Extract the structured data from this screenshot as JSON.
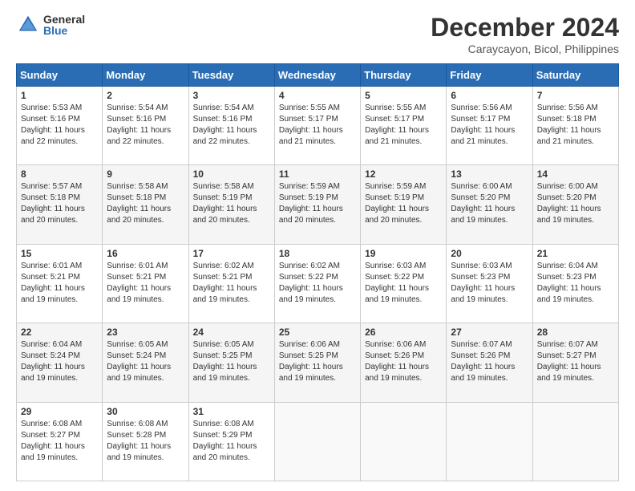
{
  "header": {
    "logo_general": "General",
    "logo_blue": "Blue",
    "title": "December 2024",
    "subtitle": "Caraycayon, Bicol, Philippines"
  },
  "weekdays": [
    "Sunday",
    "Monday",
    "Tuesday",
    "Wednesday",
    "Thursday",
    "Friday",
    "Saturday"
  ],
  "weeks": [
    [
      {
        "day": 1,
        "sunrise": "5:53 AM",
        "sunset": "5:16 PM",
        "daylight": "11 hours and 22 minutes."
      },
      {
        "day": 2,
        "sunrise": "5:54 AM",
        "sunset": "5:16 PM",
        "daylight": "11 hours and 22 minutes."
      },
      {
        "day": 3,
        "sunrise": "5:54 AM",
        "sunset": "5:16 PM",
        "daylight": "11 hours and 22 minutes."
      },
      {
        "day": 4,
        "sunrise": "5:55 AM",
        "sunset": "5:17 PM",
        "daylight": "11 hours and 21 minutes."
      },
      {
        "day": 5,
        "sunrise": "5:55 AM",
        "sunset": "5:17 PM",
        "daylight": "11 hours and 21 minutes."
      },
      {
        "day": 6,
        "sunrise": "5:56 AM",
        "sunset": "5:17 PM",
        "daylight": "11 hours and 21 minutes."
      },
      {
        "day": 7,
        "sunrise": "5:56 AM",
        "sunset": "5:18 PM",
        "daylight": "11 hours and 21 minutes."
      }
    ],
    [
      {
        "day": 8,
        "sunrise": "5:57 AM",
        "sunset": "5:18 PM",
        "daylight": "11 hours and 20 minutes."
      },
      {
        "day": 9,
        "sunrise": "5:58 AM",
        "sunset": "5:18 PM",
        "daylight": "11 hours and 20 minutes."
      },
      {
        "day": 10,
        "sunrise": "5:58 AM",
        "sunset": "5:19 PM",
        "daylight": "11 hours and 20 minutes."
      },
      {
        "day": 11,
        "sunrise": "5:59 AM",
        "sunset": "5:19 PM",
        "daylight": "11 hours and 20 minutes."
      },
      {
        "day": 12,
        "sunrise": "5:59 AM",
        "sunset": "5:19 PM",
        "daylight": "11 hours and 20 minutes."
      },
      {
        "day": 13,
        "sunrise": "6:00 AM",
        "sunset": "5:20 PM",
        "daylight": "11 hours and 19 minutes."
      },
      {
        "day": 14,
        "sunrise": "6:00 AM",
        "sunset": "5:20 PM",
        "daylight": "11 hours and 19 minutes."
      }
    ],
    [
      {
        "day": 15,
        "sunrise": "6:01 AM",
        "sunset": "5:21 PM",
        "daylight": "11 hours and 19 minutes."
      },
      {
        "day": 16,
        "sunrise": "6:01 AM",
        "sunset": "5:21 PM",
        "daylight": "11 hours and 19 minutes."
      },
      {
        "day": 17,
        "sunrise": "6:02 AM",
        "sunset": "5:21 PM",
        "daylight": "11 hours and 19 minutes."
      },
      {
        "day": 18,
        "sunrise": "6:02 AM",
        "sunset": "5:22 PM",
        "daylight": "11 hours and 19 minutes."
      },
      {
        "day": 19,
        "sunrise": "6:03 AM",
        "sunset": "5:22 PM",
        "daylight": "11 hours and 19 minutes."
      },
      {
        "day": 20,
        "sunrise": "6:03 AM",
        "sunset": "5:23 PM",
        "daylight": "11 hours and 19 minutes."
      },
      {
        "day": 21,
        "sunrise": "6:04 AM",
        "sunset": "5:23 PM",
        "daylight": "11 hours and 19 minutes."
      }
    ],
    [
      {
        "day": 22,
        "sunrise": "6:04 AM",
        "sunset": "5:24 PM",
        "daylight": "11 hours and 19 minutes."
      },
      {
        "day": 23,
        "sunrise": "6:05 AM",
        "sunset": "5:24 PM",
        "daylight": "11 hours and 19 minutes."
      },
      {
        "day": 24,
        "sunrise": "6:05 AM",
        "sunset": "5:25 PM",
        "daylight": "11 hours and 19 minutes."
      },
      {
        "day": 25,
        "sunrise": "6:06 AM",
        "sunset": "5:25 PM",
        "daylight": "11 hours and 19 minutes."
      },
      {
        "day": 26,
        "sunrise": "6:06 AM",
        "sunset": "5:26 PM",
        "daylight": "11 hours and 19 minutes."
      },
      {
        "day": 27,
        "sunrise": "6:07 AM",
        "sunset": "5:26 PM",
        "daylight": "11 hours and 19 minutes."
      },
      {
        "day": 28,
        "sunrise": "6:07 AM",
        "sunset": "5:27 PM",
        "daylight": "11 hours and 19 minutes."
      }
    ],
    [
      {
        "day": 29,
        "sunrise": "6:08 AM",
        "sunset": "5:27 PM",
        "daylight": "11 hours and 19 minutes."
      },
      {
        "day": 30,
        "sunrise": "6:08 AM",
        "sunset": "5:28 PM",
        "daylight": "11 hours and 19 minutes."
      },
      {
        "day": 31,
        "sunrise": "6:08 AM",
        "sunset": "5:29 PM",
        "daylight": "11 hours and 20 minutes."
      },
      null,
      null,
      null,
      null
    ]
  ]
}
